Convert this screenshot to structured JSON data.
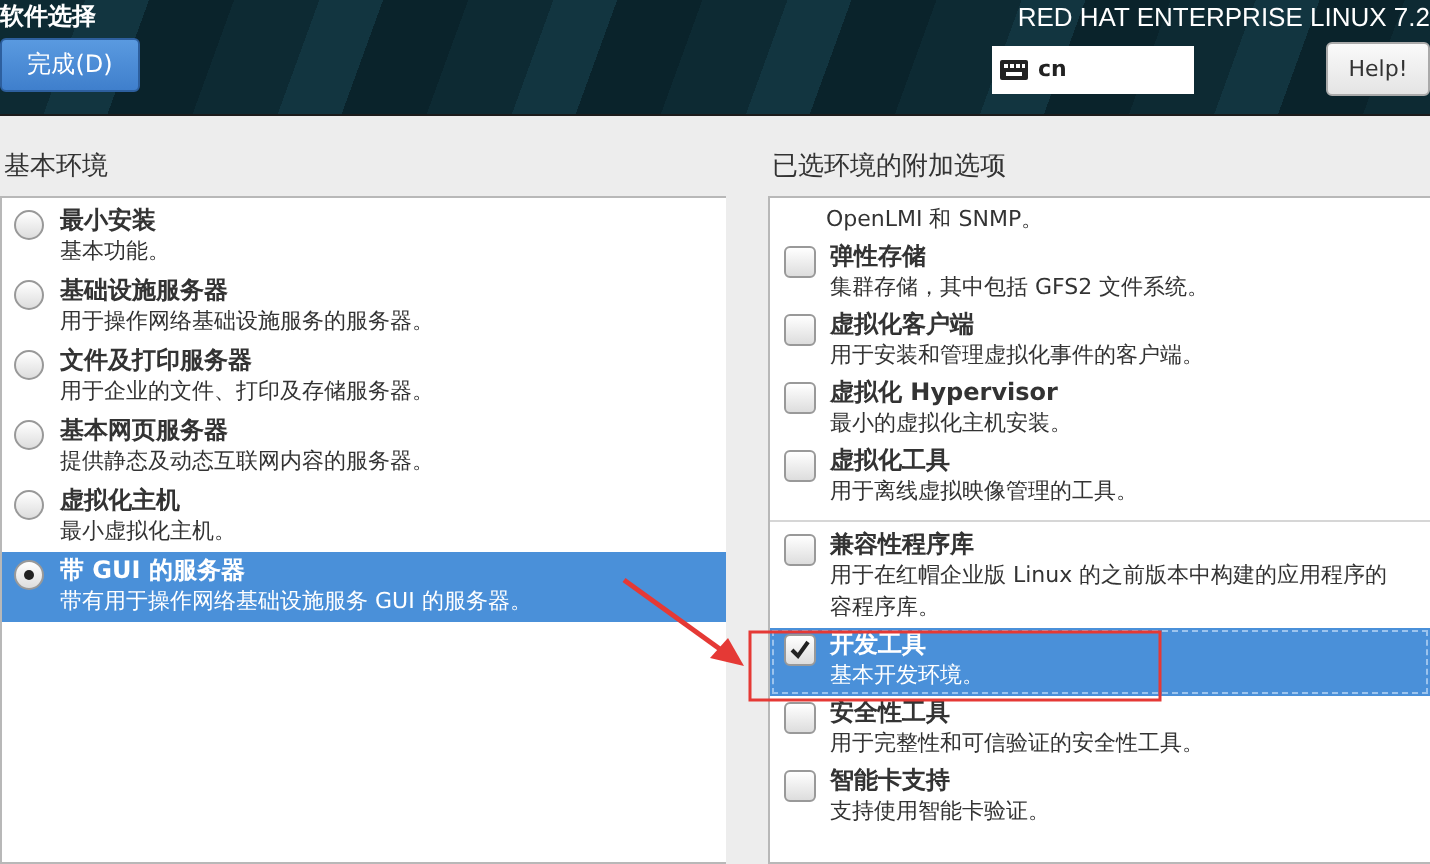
{
  "header": {
    "title": "软件选择",
    "done_button": "完成(D)",
    "product": "RED HAT ENTERPRISE LINUX 7.2",
    "keyboard_layout": "cn",
    "help_button": "Help!"
  },
  "base_environment": {
    "heading": "基本环境",
    "items": [
      {
        "name": "最小安装",
        "description": "基本功能。",
        "selected": false
      },
      {
        "name": "基础设施服务器",
        "description": "用于操作网络基础设施服务的服务器。",
        "selected": false
      },
      {
        "name": "文件及打印服务器",
        "description": "用于企业的文件、打印及存储服务器。",
        "selected": false
      },
      {
        "name": "基本网页服务器",
        "description": "提供静态及动态互联网内容的服务器。",
        "selected": false
      },
      {
        "name": "虚拟化主机",
        "description": "最小虚拟化主机。",
        "selected": false
      },
      {
        "name": "带 GUI 的服务器",
        "description": "带有用于操作网络基础设施服务 GUI 的服务器。",
        "selected": true
      }
    ]
  },
  "addons": {
    "heading": "已选环境的附加选项",
    "items": [
      {
        "kind": "continuation",
        "description_lines": [
          "OpenLMI 和 SNMP。"
        ]
      },
      {
        "kind": "option",
        "name": "弹性存储",
        "description_lines": [
          "集群存储，其中包括 GFS2 文件系统。"
        ],
        "checked": false,
        "selected": false,
        "divider_before": false
      },
      {
        "kind": "option",
        "name": "虚拟化客户端",
        "description_lines": [
          "用于安装和管理虚拟化事件的客户端。"
        ],
        "checked": false,
        "selected": false,
        "divider_before": false
      },
      {
        "kind": "option",
        "name": "虚拟化 Hypervisor",
        "description_lines": [
          "最小的虚拟化主机安装。"
        ],
        "checked": false,
        "selected": false,
        "divider_before": false
      },
      {
        "kind": "option",
        "name": "虚拟化工具",
        "description_lines": [
          "用于离线虚拟映像管理的工具。"
        ],
        "checked": false,
        "selected": false,
        "divider_before": false
      },
      {
        "kind": "option",
        "name": "兼容性程序库",
        "description_lines": [
          "用于在红帽企业版 Linux 的之前版本中构建的应用程序的",
          "容程序库。"
        ],
        "checked": false,
        "selected": false,
        "divider_before": true
      },
      {
        "kind": "option",
        "name": "开发工具",
        "description_lines": [
          "基本开发环境。"
        ],
        "checked": true,
        "selected": true,
        "divider_before": false
      },
      {
        "kind": "option",
        "name": "安全性工具",
        "description_lines": [
          "用于完整性和可信验证的安全性工具。"
        ],
        "checked": false,
        "selected": false,
        "divider_before": false
      },
      {
        "kind": "option",
        "name": "智能卡支持",
        "description_lines": [
          "支持使用智能卡验证。"
        ],
        "checked": false,
        "selected": false,
        "divider_before": false
      }
    ]
  }
}
